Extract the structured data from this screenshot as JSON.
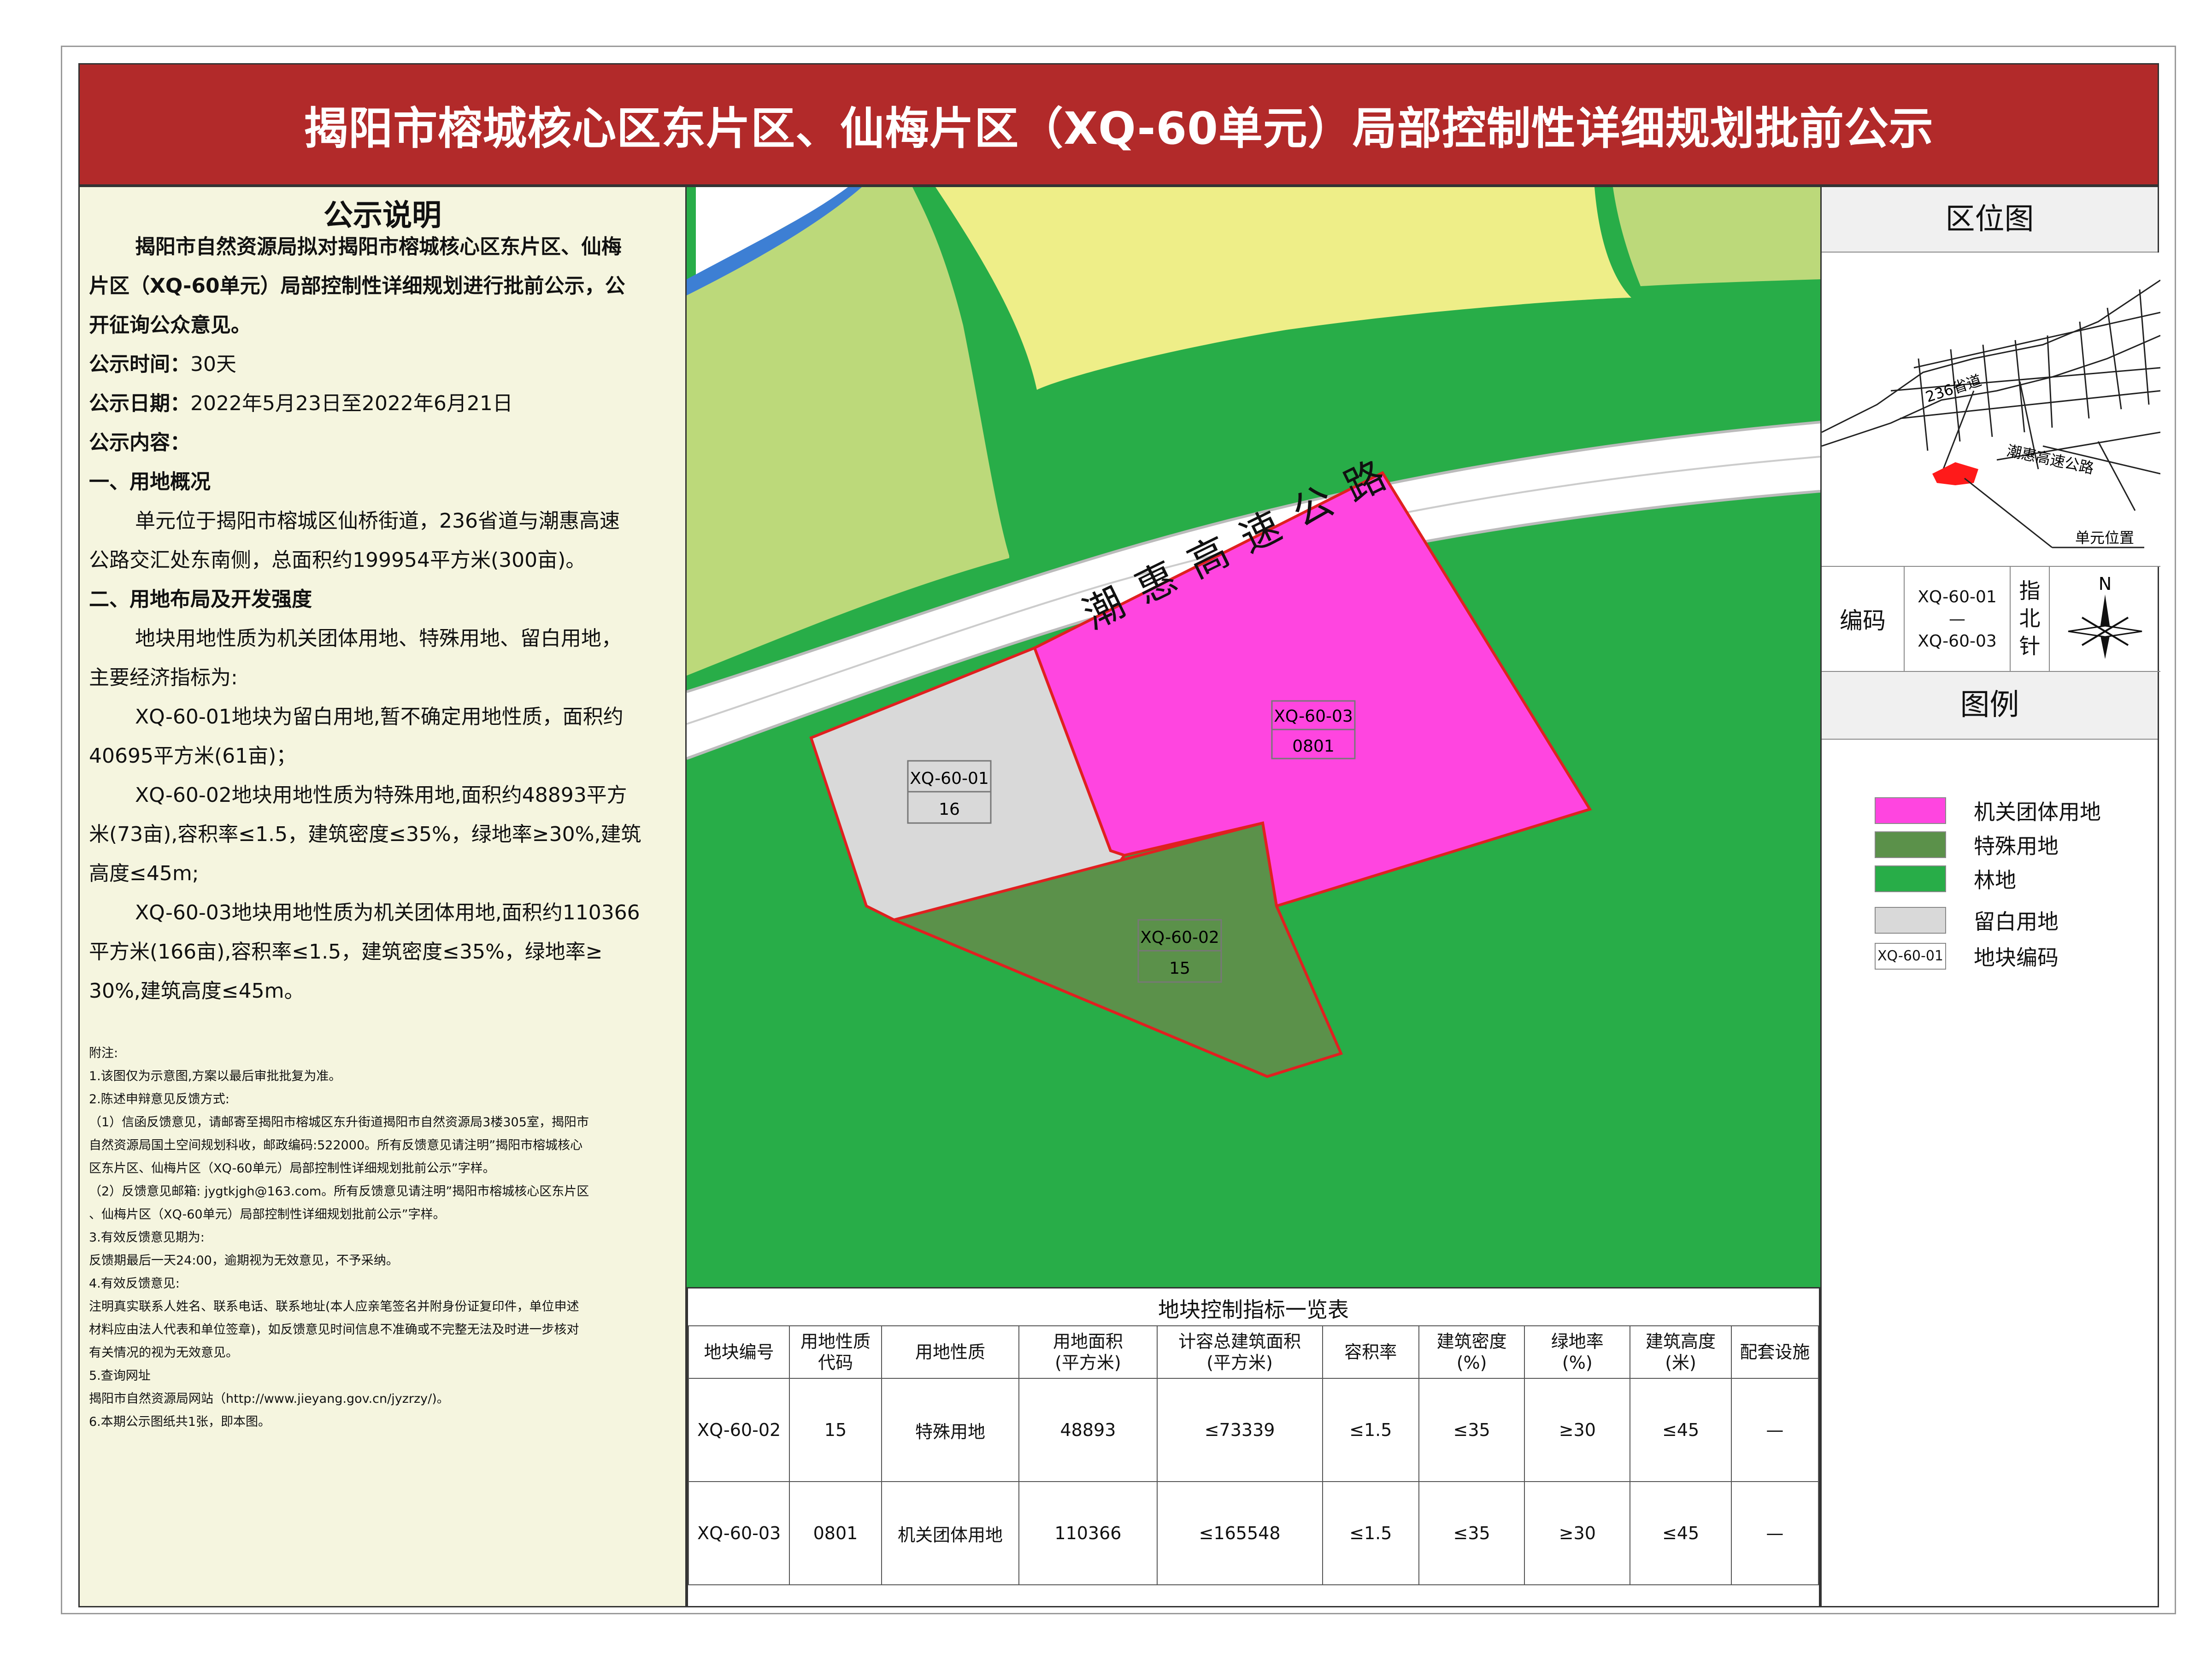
{
  "title": "揭阳市榕城核心区东片区、仙梅片区（XQ-60单元）局部控制性详细规划批前公示",
  "notice": {
    "heading": "公示说明",
    "intro1": "揭阳市自然资源局拟对揭阳市榕城核心区东片区、仙梅",
    "intro2": "片区（XQ-60单元）局部控制性详细规划进行批前公示，公",
    "intro3": "开征询公众意见。",
    "time_label": "公示时间：",
    "time_value": "30天",
    "date_label": "公示日期：",
    "date_value": "2022年5月23日至2022年6月21日",
    "content_label": "公示内容：",
    "s1_title": "一、用地概况",
    "s1_l1": "单元位于揭阳市榕城区仙桥街道，236省道与潮惠高速",
    "s1_l2": "公路交汇处东南侧，总面积约199954平方米(300亩)。",
    "s2_title": "二、用地布局及开发强度",
    "s2_l1": "地块用地性质为机关团体用地、特殊用地、留白用地，",
    "s2_l2": "主要经济指标为:",
    "p1_l1": "XQ-60-01地块为留白用地,暂不确定用地性质，面积约",
    "p1_l2": "40695平方米(61亩)；",
    "p2_l1": "XQ-60-02地块用地性质为特殊用地,面积约48893平方",
    "p2_l2": "米(73亩),容积率≤1.5，建筑密度≤35%，绿地率≥30%,建筑",
    "p2_l3": "高度≤45m;",
    "p3_l1": "XQ-60-03地块用地性质为机关团体用地,面积约110366",
    "p3_l2": "平方米(166亩),容积率≤1.5，建筑密度≤35%，绿地率≥",
    "p3_l3": "30%,建筑高度≤45m。"
  },
  "notes": [
    "附注:",
    "1.该图仅为示意图,方案以最后审批批复为准。",
    "2.陈述申辩意见反馈方式:",
    "（1）信函反馈意见，请邮寄至揭阳市榕城区东升街道揭阳市自然资源局3楼305室，揭阳市",
    "自然资源局国土空间规划科收，邮政编码:522000。所有反馈意见请注明”揭阳市榕城核心",
    "区东片区、仙梅片区（XQ-60单元）局部控制性详细规划批前公示”字样。",
    "（2）反馈意见邮箱: jygtkjgh@163.com。所有反馈意见请注明”揭阳市榕城核心区东片区",
    "、仙梅片区（XQ-60单元）局部控制性详细规划批前公示”字样。",
    "3.有效反馈意见期为:",
    "反馈期最后一天24:00，逾期视为无效意见，不予采纳。",
    "4.有效反馈意见:",
    "注明真实联系人姓名、联系电话、联系地址(本人应亲笔签名并附身份证复印件，单位申述",
    "材料应由法人代表和单位签章)，如反馈意见时间信息不准确或不完整无法及时进一步核对",
    "有关情况的视为无效意见。",
    "5.查询网址",
    "揭阳市自然资源局网站（http://www.jieyang.gov.cn/jyzrzy/)。",
    "6.本期公示图纸共1张，即本图。"
  ],
  "map": {
    "road_label": "潮惠高速公路",
    "parcels": [
      {
        "code": "XQ-60-01",
        "type": "16"
      },
      {
        "code": "XQ-60-02",
        "type": "15"
      },
      {
        "code": "XQ-60-03",
        "type": "0801"
      }
    ],
    "colors": {
      "forest": "#28ad48",
      "office": "#ff45e0",
      "special": "#5b914a",
      "reserved": "#d9d9d9",
      "yellow_land": "#eeee88",
      "light_green_land": "#bcd97a",
      "road": "#ffffff",
      "water": "#3d7fd4"
    }
  },
  "table": {
    "title": "地块控制指标一览表",
    "headers": [
      [
        "地块编号"
      ],
      [
        "用地性质",
        "代码"
      ],
      [
        "用地性质"
      ],
      [
        "用地面积",
        "(平方米)"
      ],
      [
        "计容总建筑面积",
        "(平方米)"
      ],
      [
        "容积率"
      ],
      [
        "建筑密度",
        "(%)"
      ],
      [
        "绿地率",
        "(%)"
      ],
      [
        "建筑高度",
        "(米)"
      ],
      [
        "配套设施"
      ]
    ],
    "rows": [
      [
        "XQ-60-02",
        "15",
        "特殊用地",
        "48893",
        "≤73339",
        "≤1.5",
        "≤35",
        "≥30",
        "≤45",
        "—"
      ],
      [
        "XQ-60-03",
        "0801",
        "机关团体用地",
        "110366",
        "≤165548",
        "≤1.5",
        "≤35",
        "≥30",
        "≤45",
        "—"
      ]
    ]
  },
  "location": {
    "heading": "区位图",
    "road1": "236省道",
    "road2": "潮惠高速公路",
    "unit_label": "单元位置"
  },
  "code_box": {
    "label": "编码",
    "from": "XQ-60-01",
    "dash": "—",
    "to": "XQ-60-03",
    "compass_label": [
      "指",
      "北",
      "针"
    ],
    "north": "N"
  },
  "legend": {
    "heading": "图例",
    "items": [
      {
        "label": "机关团体用地",
        "color": "#ff45e0"
      },
      {
        "label": "特殊用地",
        "color": "#5b914a"
      },
      {
        "label": "林地",
        "color": "#28ad48"
      },
      {
        "label": "留白用地",
        "color": "#d9d9d9"
      }
    ],
    "code_sample": "XQ-60-01",
    "code_label": "地块编码"
  }
}
